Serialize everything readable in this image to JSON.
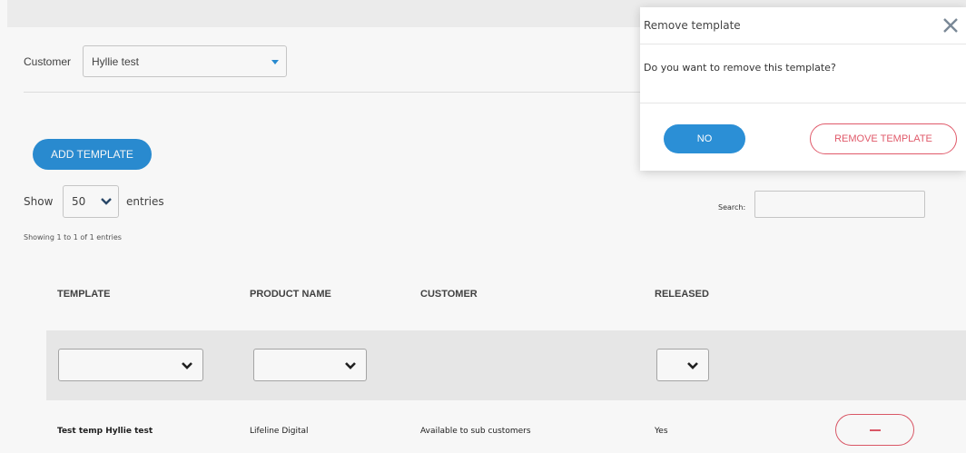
{
  "customer": {
    "label": "Customer",
    "selected": "Hyllie test"
  },
  "actions": {
    "add_template_label": "ADD TEMPLATE"
  },
  "table_controls": {
    "show_label": "Show",
    "length_value": "50",
    "entries_label": "entries",
    "info": "Showing 1 to 1 of 1 entries",
    "search_label": "Search:",
    "search_value": ""
  },
  "table": {
    "columns": [
      "TEMPLATE",
      "PRODUCT NAME",
      "CUSTOMER",
      "RELEASED"
    ],
    "rows": [
      {
        "template": "Test temp Hyllie test",
        "product_name": "Lifeline Digital",
        "customer": "Available to sub customers",
        "released": "Yes"
      }
    ]
  },
  "modal": {
    "title": "Remove template",
    "message": "Do you want to remove this template?",
    "no_label": "NO",
    "remove_label": "REMOVE TEMPLATE"
  },
  "colors": {
    "accent": "#2b8fd6",
    "danger": "#e05a6a"
  },
  "icons": {
    "close": "close-icon",
    "chevron": "chevron-down-icon",
    "caret": "caret-down-icon",
    "minus": "minus-icon"
  }
}
